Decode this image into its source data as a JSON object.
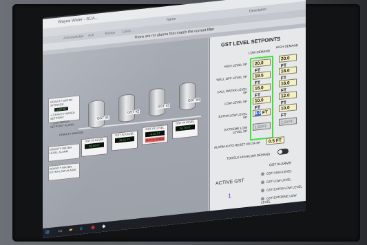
{
  "window": {
    "title": "Wayne Water - SCA..."
  },
  "header": {
    "name_col": "Name",
    "description_col": "Description"
  },
  "tabs": [
    {
      "label": "Acknowledge"
    },
    {
      "label": "Ack"
    },
    {
      "label": "Shelve"
    },
    {
      "label": "Unsh..."
    }
  ],
  "alarm_message": "There are no alarms that match the current filter",
  "plant": {
    "side_panel": {
      "title": "GRAVITY WATER STORAGE",
      "value": "3.07 IN",
      "items": [
        "GRAVITY WATER SETPOINT",
        "LOW WATER SETPOINT ALARM"
      ]
    },
    "gravity_label": "GRAVITY MASTER",
    "left_box_1": "GRAVITY WATER LEVEL ALARM",
    "left_box_2": "GRAVITY WATER EXTRA LOW ALARM",
    "tanks": [
      {
        "name": "GST #1",
        "level_label": "GST #1 LEVEL",
        "level": "36.40 FT",
        "status": "normal"
      },
      {
        "name": "GST #2",
        "level_label": "GST #2 LEVEL",
        "level": "36.41 FT",
        "status": "normal"
      },
      {
        "name": "GST #3",
        "level_label": "GST #3 LEVEL",
        "level": "-0.40 FT",
        "status": "OUT OF RANGE"
      },
      {
        "name": "GST #4",
        "level_label": "GST #4 LEVEL",
        "level": "36.78 FT",
        "status": "normal"
      }
    ]
  },
  "setpoints": {
    "title": "GST LEVEL SETPOINTS",
    "low_demand_header": "LOW DEMAND",
    "high_demand_header": "HIGH DEMAND",
    "rows": [
      {
        "label": "HIGH LEVEL SP",
        "low": "20.0",
        "high": "20.0",
        "unit": "FT"
      },
      {
        "label": "WELL OFF LEVEL SP",
        "low": "19.5",
        "high": "18.0",
        "unit": "FT"
      },
      {
        "label": "CALL WATER LEVEL SP",
        "low": "18.0",
        "high": "16.0",
        "unit": "FT"
      },
      {
        "label": "LOW LEVEL SP",
        "low": "10.0",
        "high": "12.0",
        "unit": "FT"
      },
      {
        "label": "EXTRA LOW LEVEL SP",
        "low": "8.0",
        "high": "10.0",
        "unit": "FT"
      },
      {
        "label": "EXTREME LOW LEVEL SP",
        "low": "1.50",
        "high": "1.50",
        "unit": "FT"
      }
    ],
    "alarm_reset_label": "ALARM AUTO RESET DELTA SP",
    "alarm_reset_value": "0.5",
    "alarm_reset_unit": "FT",
    "toggle_label": "TOGGLE HIGH/LOW DEMAND"
  },
  "active_gst": {
    "label": "ACTIVE GST",
    "value": "1"
  },
  "alarms": {
    "title": "GST ALARMS",
    "items": [
      "GST HIGH LEVEL",
      "GST LOW LEVEL",
      "GST EXTRA LOW LEVEL",
      "GST EXTREME LOW LEVEL"
    ]
  },
  "colors": {
    "selected_col_border": "#3ee03a",
    "input_bg": "#f5f0c4",
    "active_gst": "#8a2fd0"
  }
}
